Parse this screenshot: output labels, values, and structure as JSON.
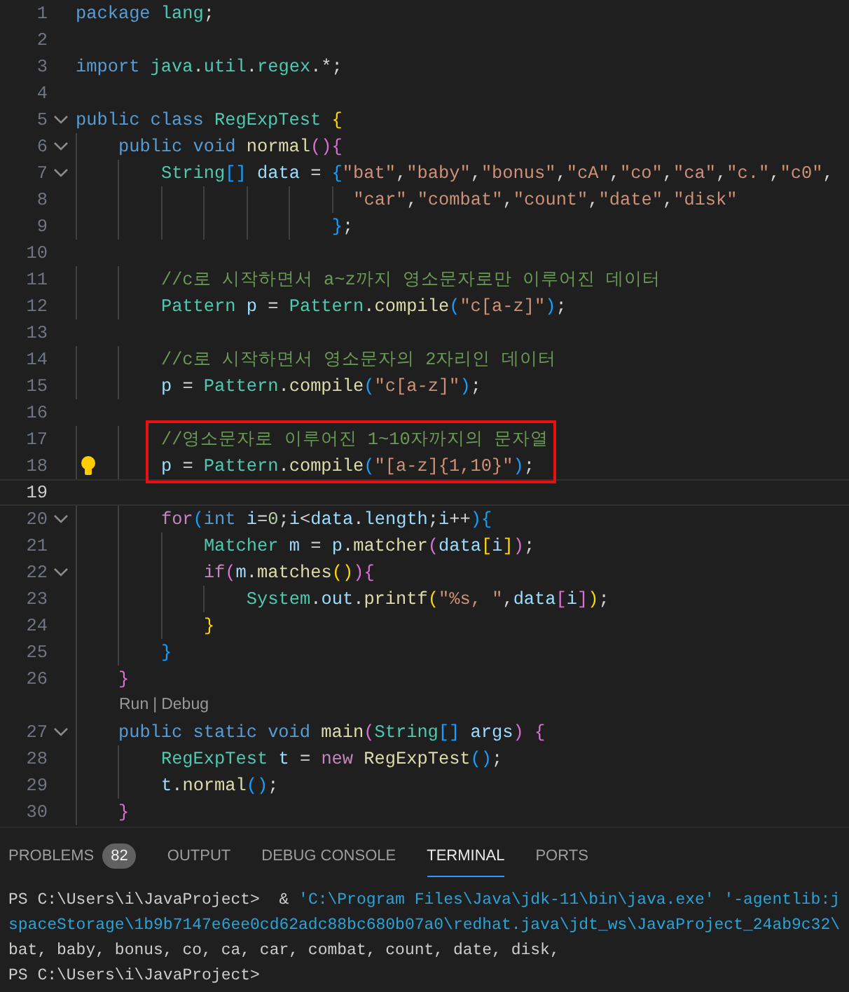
{
  "editor": {
    "lines": [
      {
        "kind": "code",
        "number": "1",
        "foldable": false,
        "current": false,
        "boxed": false,
        "lightbulb": false,
        "tokens": [
          {
            "text": "package ",
            "kind": "kw"
          },
          {
            "text": "lang",
            "kind": "typ"
          },
          {
            "text": ";",
            "kind": "txt"
          }
        ]
      },
      {
        "kind": "code",
        "number": "2",
        "foldable": false,
        "current": false,
        "boxed": false,
        "lightbulb": false
      },
      {
        "kind": "code",
        "number": "3",
        "foldable": false,
        "current": false,
        "boxed": false,
        "lightbulb": false,
        "tokens": [
          {
            "text": "import ",
            "kind": "kw"
          },
          {
            "text": "java",
            "kind": "typ"
          },
          {
            "text": ".",
            "kind": "txt"
          },
          {
            "text": "util",
            "kind": "typ"
          },
          {
            "text": ".",
            "kind": "txt"
          },
          {
            "text": "regex",
            "kind": "typ"
          },
          {
            "text": ".*;",
            "kind": "txt"
          }
        ]
      },
      {
        "kind": "code",
        "number": "4",
        "foldable": false,
        "current": false,
        "boxed": false,
        "lightbulb": false
      },
      {
        "kind": "code",
        "number": "5",
        "foldable": true,
        "current": false,
        "boxed": false,
        "lightbulb": false,
        "tokens": [
          {
            "text": "public ",
            "kind": "kw"
          },
          {
            "text": "class ",
            "kind": "kw"
          },
          {
            "text": "RegExpTest ",
            "kind": "typ"
          },
          {
            "text": "{",
            "kind": "p1"
          }
        ]
      },
      {
        "kind": "code",
        "number": "6",
        "foldable": true,
        "current": false,
        "boxed": false,
        "lightbulb": false,
        "tokens": [
          {
            "text": "    public ",
            "kind": "kw"
          },
          {
            "text": "void ",
            "kind": "kw"
          },
          {
            "text": "normal",
            "kind": "fn"
          },
          {
            "text": "()",
            "kind": "p2"
          },
          {
            "text": "{",
            "kind": "p2"
          }
        ]
      },
      {
        "kind": "code",
        "number": "7",
        "foldable": true,
        "current": false,
        "boxed": false,
        "lightbulb": false,
        "tokens": [
          {
            "text": "        String",
            "kind": "typ"
          },
          {
            "text": "[] ",
            "kind": "p3"
          },
          {
            "text": "data",
            "kind": "var"
          },
          {
            "text": " = ",
            "kind": "txt"
          },
          {
            "text": "{",
            "kind": "p3"
          },
          {
            "text": "\"bat\"",
            "kind": "str"
          },
          {
            "text": ",",
            "kind": "txt"
          },
          {
            "text": "\"baby\"",
            "kind": "str"
          },
          {
            "text": ",",
            "kind": "txt"
          },
          {
            "text": "\"bonus\"",
            "kind": "str"
          },
          {
            "text": ",",
            "kind": "txt"
          },
          {
            "text": "\"cA\"",
            "kind": "str"
          },
          {
            "text": ",",
            "kind": "txt"
          },
          {
            "text": "\"co\"",
            "kind": "str"
          },
          {
            "text": ",",
            "kind": "txt"
          },
          {
            "text": "\"ca\"",
            "kind": "str"
          },
          {
            "text": ",",
            "kind": "txt"
          },
          {
            "text": "\"c.\"",
            "kind": "str"
          },
          {
            "text": ",",
            "kind": "txt"
          },
          {
            "text": "\"c0\"",
            "kind": "str"
          },
          {
            "text": ",",
            "kind": "txt"
          }
        ]
      },
      {
        "kind": "code",
        "number": "8",
        "foldable": false,
        "current": false,
        "boxed": false,
        "lightbulb": false,
        "tokens": [
          {
            "text": "                          \"car\"",
            "kind": "str"
          },
          {
            "text": ",",
            "kind": "txt"
          },
          {
            "text": "\"combat\"",
            "kind": "str"
          },
          {
            "text": ",",
            "kind": "txt"
          },
          {
            "text": "\"count\"",
            "kind": "str"
          },
          {
            "text": ",",
            "kind": "txt"
          },
          {
            "text": "\"date\"",
            "kind": "str"
          },
          {
            "text": ",",
            "kind": "txt"
          },
          {
            "text": "\"disk\"",
            "kind": "str"
          }
        ]
      },
      {
        "kind": "code",
        "number": "9",
        "foldable": false,
        "current": false,
        "boxed": false,
        "lightbulb": false,
        "tokens": [
          {
            "text": "                        }",
            "kind": "p3"
          },
          {
            "text": ";",
            "kind": "txt"
          }
        ]
      },
      {
        "kind": "code",
        "number": "10",
        "foldable": false,
        "current": false,
        "boxed": false,
        "lightbulb": false
      },
      {
        "kind": "code",
        "number": "11",
        "foldable": false,
        "current": false,
        "boxed": false,
        "lightbulb": false,
        "tokens": [
          {
            "text": "        //c로 시작하면서 a~z까지 영소문자로만 이루어진 데이터",
            "kind": "com"
          }
        ]
      },
      {
        "kind": "code",
        "number": "12",
        "foldable": false,
        "current": false,
        "boxed": false,
        "lightbulb": false,
        "tokens": [
          {
            "text": "        Pattern ",
            "kind": "typ"
          },
          {
            "text": "p",
            "kind": "var"
          },
          {
            "text": " = ",
            "kind": "txt"
          },
          {
            "text": "Pattern",
            "kind": "typ"
          },
          {
            "text": ".",
            "kind": "txt"
          },
          {
            "text": "compile",
            "kind": "fn"
          },
          {
            "text": "(",
            "kind": "p3"
          },
          {
            "text": "\"c[a-z]\"",
            "kind": "str"
          },
          {
            "text": ")",
            "kind": "p3"
          },
          {
            "text": ";",
            "kind": "txt"
          }
        ]
      },
      {
        "kind": "code",
        "number": "13",
        "foldable": false,
        "current": false,
        "boxed": false,
        "lightbulb": false
      },
      {
        "kind": "code",
        "number": "14",
        "foldable": false,
        "current": false,
        "boxed": false,
        "lightbulb": false,
        "tokens": [
          {
            "text": "        //c로 시작하면서 영소문자의 2자리인 데이터",
            "kind": "com"
          }
        ]
      },
      {
        "kind": "code",
        "number": "15",
        "foldable": false,
        "current": false,
        "boxed": false,
        "lightbulb": false,
        "tokens": [
          {
            "text": "        p",
            "kind": "var"
          },
          {
            "text": " = ",
            "kind": "txt"
          },
          {
            "text": "Pattern",
            "kind": "typ"
          },
          {
            "text": ".",
            "kind": "txt"
          },
          {
            "text": "compile",
            "kind": "fn"
          },
          {
            "text": "(",
            "kind": "p3"
          },
          {
            "text": "\"c[a-z]\"",
            "kind": "str"
          },
          {
            "text": ")",
            "kind": "p3"
          },
          {
            "text": ";",
            "kind": "txt"
          }
        ]
      },
      {
        "kind": "code",
        "number": "16",
        "foldable": false,
        "current": false,
        "boxed": false,
        "lightbulb": false
      },
      {
        "kind": "code",
        "number": "17",
        "foldable": false,
        "current": false,
        "boxed": true,
        "lightbulb": false,
        "tokens": [
          {
            "text": "        //영소문자로 이루어진 1~10자까지의 문자열",
            "kind": "com"
          }
        ]
      },
      {
        "kind": "code",
        "number": "18",
        "foldable": false,
        "current": false,
        "boxed": true,
        "lightbulb": true,
        "tokens": [
          {
            "text": "        p",
            "kind": "var"
          },
          {
            "text": " = ",
            "kind": "txt"
          },
          {
            "text": "Pattern",
            "kind": "typ"
          },
          {
            "text": ".",
            "kind": "txt"
          },
          {
            "text": "compile",
            "kind": "fn"
          },
          {
            "text": "(",
            "kind": "p3"
          },
          {
            "text": "\"[a-z]{1,10}\"",
            "kind": "str"
          },
          {
            "text": ")",
            "kind": "p3"
          },
          {
            "text": ";",
            "kind": "txt"
          }
        ]
      },
      {
        "kind": "code",
        "number": "19",
        "foldable": false,
        "current": true,
        "boxed": false,
        "lightbulb": false
      },
      {
        "kind": "code",
        "number": "20",
        "foldable": true,
        "current": false,
        "boxed": false,
        "lightbulb": false,
        "tokens": [
          {
            "text": "        for",
            "kind": "ctl"
          },
          {
            "text": "(",
            "kind": "p3"
          },
          {
            "text": "int ",
            "kind": "kw"
          },
          {
            "text": "i",
            "kind": "var"
          },
          {
            "text": "=",
            "kind": "txt"
          },
          {
            "text": "0",
            "kind": "num"
          },
          {
            "text": ";",
            "kind": "txt"
          },
          {
            "text": "i",
            "kind": "var"
          },
          {
            "text": "<",
            "kind": "txt"
          },
          {
            "text": "data",
            "kind": "var"
          },
          {
            "text": ".",
            "kind": "txt"
          },
          {
            "text": "length",
            "kind": "var"
          },
          {
            "text": ";",
            "kind": "txt"
          },
          {
            "text": "i",
            "kind": "var"
          },
          {
            "text": "++",
            "kind": "txt"
          },
          {
            "text": ")",
            "kind": "p3"
          },
          {
            "text": "{",
            "kind": "p3"
          }
        ]
      },
      {
        "kind": "code",
        "number": "21",
        "foldable": false,
        "current": false,
        "boxed": false,
        "lightbulb": false,
        "tokens": [
          {
            "text": "            Matcher ",
            "kind": "typ"
          },
          {
            "text": "m",
            "kind": "var"
          },
          {
            "text": " = ",
            "kind": "txt"
          },
          {
            "text": "p",
            "kind": "var"
          },
          {
            "text": ".",
            "kind": "txt"
          },
          {
            "text": "matcher",
            "kind": "fn"
          },
          {
            "text": "(",
            "kind": "p2"
          },
          {
            "text": "data",
            "kind": "var"
          },
          {
            "text": "[",
            "kind": "p1"
          },
          {
            "text": "i",
            "kind": "var"
          },
          {
            "text": "]",
            "kind": "p1"
          },
          {
            "text": ")",
            "kind": "p2"
          },
          {
            "text": ";",
            "kind": "txt"
          }
        ]
      },
      {
        "kind": "code",
        "number": "22",
        "foldable": true,
        "current": false,
        "boxed": false,
        "lightbulb": false,
        "tokens": [
          {
            "text": "            if",
            "kind": "ctl"
          },
          {
            "text": "(",
            "kind": "p2"
          },
          {
            "text": "m",
            "kind": "var"
          },
          {
            "text": ".",
            "kind": "txt"
          },
          {
            "text": "matches",
            "kind": "fn"
          },
          {
            "text": "()",
            "kind": "p1"
          },
          {
            "text": ")",
            "kind": "p2"
          },
          {
            "text": "{",
            "kind": "p2"
          }
        ]
      },
      {
        "kind": "code",
        "number": "23",
        "foldable": false,
        "current": false,
        "boxed": false,
        "lightbulb": false,
        "tokens": [
          {
            "text": "                System",
            "kind": "typ"
          },
          {
            "text": ".",
            "kind": "txt"
          },
          {
            "text": "out",
            "kind": "var"
          },
          {
            "text": ".",
            "kind": "txt"
          },
          {
            "text": "printf",
            "kind": "fn"
          },
          {
            "text": "(",
            "kind": "p1"
          },
          {
            "text": "\"%s, \"",
            "kind": "str"
          },
          {
            "text": ",",
            "kind": "txt"
          },
          {
            "text": "data",
            "kind": "var"
          },
          {
            "text": "[",
            "kind": "p2"
          },
          {
            "text": "i",
            "kind": "var"
          },
          {
            "text": "]",
            "kind": "p2"
          },
          {
            "text": ")",
            "kind": "p1"
          },
          {
            "text": ";",
            "kind": "txt"
          }
        ]
      },
      {
        "kind": "code",
        "number": "24",
        "foldable": false,
        "current": false,
        "boxed": false,
        "lightbulb": false,
        "tokens": [
          {
            "text": "            }",
            "kind": "p1"
          }
        ]
      },
      {
        "kind": "code",
        "number": "25",
        "foldable": false,
        "current": false,
        "boxed": false,
        "lightbulb": false,
        "tokens": [
          {
            "text": "        }",
            "kind": "p3"
          }
        ]
      },
      {
        "kind": "code",
        "number": "26",
        "foldable": false,
        "current": false,
        "boxed": false,
        "lightbulb": false,
        "tokens": [
          {
            "text": "    }",
            "kind": "p2"
          }
        ]
      },
      {
        "kind": "codelens",
        "run": "Run",
        "separator": "|",
        "debug": "Debug"
      },
      {
        "kind": "code",
        "number": "27",
        "foldable": true,
        "current": false,
        "boxed": false,
        "lightbulb": false,
        "tokens": [
          {
            "text": "    public ",
            "kind": "kw"
          },
          {
            "text": "static ",
            "kind": "kw"
          },
          {
            "text": "void ",
            "kind": "kw"
          },
          {
            "text": "main",
            "kind": "fn"
          },
          {
            "text": "(",
            "kind": "p2"
          },
          {
            "text": "String",
            "kind": "typ"
          },
          {
            "text": "[] ",
            "kind": "p3"
          },
          {
            "text": "args",
            "kind": "var"
          },
          {
            "text": ") ",
            "kind": "p2"
          },
          {
            "text": "{",
            "kind": "p2"
          }
        ]
      },
      {
        "kind": "code",
        "number": "28",
        "foldable": false,
        "current": false,
        "boxed": false,
        "lightbulb": false,
        "tokens": [
          {
            "text": "        RegExpTest ",
            "kind": "typ"
          },
          {
            "text": "t",
            "kind": "var"
          },
          {
            "text": " = ",
            "kind": "txt"
          },
          {
            "text": "new ",
            "kind": "ctl"
          },
          {
            "text": "RegExpTest",
            "kind": "fn"
          },
          {
            "text": "()",
            "kind": "p3"
          },
          {
            "text": ";",
            "kind": "txt"
          }
        ]
      },
      {
        "kind": "code",
        "number": "29",
        "foldable": false,
        "current": false,
        "boxed": false,
        "lightbulb": false,
        "tokens": [
          {
            "text": "        t",
            "kind": "var"
          },
          {
            "text": ".",
            "kind": "txt"
          },
          {
            "text": "normal",
            "kind": "fn"
          },
          {
            "text": "()",
            "kind": "p3"
          },
          {
            "text": ";",
            "kind": "txt"
          }
        ]
      },
      {
        "kind": "code",
        "number": "30",
        "foldable": false,
        "current": false,
        "boxed": false,
        "lightbulb": false,
        "tokens": [
          {
            "text": "    }",
            "kind": "p2"
          }
        ]
      }
    ]
  },
  "panel": {
    "tabs": [
      {
        "label": "PROBLEMS",
        "badge": "82",
        "selected": false
      },
      {
        "label": "OUTPUT",
        "selected": false
      },
      {
        "label": "DEBUG CONSOLE",
        "selected": false
      },
      {
        "label": "TERMINAL",
        "selected": true
      },
      {
        "label": "PORTS",
        "selected": false
      }
    ],
    "terminal": [
      [
        {
          "text": "PS C:\\Users\\i\\JavaProject>  & ",
          "kind": "plain"
        },
        {
          "text": "'C:\\Program Files\\Java\\jdk-11\\bin\\java.exe' '-agentlib:j",
          "kind": "path"
        }
      ],
      [
        {
          "text": "spaceStorage\\1b9b7147e6ee0cd62adc88bc680b07a0\\redhat.java\\jdt_ws\\JavaProject_24ab9c32\\",
          "kind": "path"
        }
      ],
      [
        {
          "text": "bat, baby, bonus, co, ca, car, combat, count, date, disk,",
          "kind": "plain"
        }
      ],
      [
        {
          "text": "PS C:\\Users\\i\\JavaProject>",
          "kind": "plain"
        }
      ]
    ]
  }
}
